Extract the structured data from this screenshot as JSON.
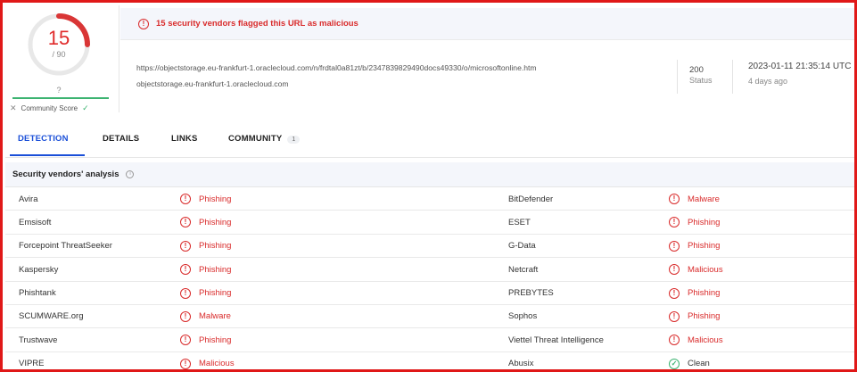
{
  "score": {
    "detections": "15",
    "total": "/ 90",
    "community_question": "?",
    "community_label": "Community Score"
  },
  "alert": {
    "icon": "alert-circle-icon",
    "text": "15 security vendors flagged this URL as malicious",
    "color": "#d92b2b"
  },
  "url": {
    "full": "https://objectstorage.eu-frankfurt-1.oraclecloud.com/n/frdtal0a81zt/b/2347839829490docs49330/o/microsoftonline.htm",
    "host": "objectstorage.eu-frankfurt-1.oraclecloud.com"
  },
  "status": {
    "code": "200",
    "label": "Status"
  },
  "date": {
    "timestamp": "2023-01-11 21:35:14 UTC",
    "relative": "4 days ago"
  },
  "tabs": [
    {
      "label": "DETECTION",
      "active": true
    },
    {
      "label": "DETAILS",
      "active": false
    },
    {
      "label": "LINKS",
      "active": false
    },
    {
      "label": "COMMUNITY",
      "badge": "1",
      "active": false
    }
  ],
  "section": {
    "title": "Security vendors' analysis"
  },
  "colors": {
    "accent": "#1a4fd8",
    "malicious": "#d92b2b",
    "clean": "#3cb371"
  },
  "vendors": [
    {
      "left": {
        "name": "Avira",
        "result": "Phishing",
        "status": "malicious"
      },
      "right": {
        "name": "BitDefender",
        "result": "Malware",
        "status": "malicious"
      }
    },
    {
      "left": {
        "name": "Emsisoft",
        "result": "Phishing",
        "status": "malicious"
      },
      "right": {
        "name": "ESET",
        "result": "Phishing",
        "status": "malicious"
      }
    },
    {
      "left": {
        "name": "Forcepoint ThreatSeeker",
        "result": "Phishing",
        "status": "malicious"
      },
      "right": {
        "name": "G-Data",
        "result": "Phishing",
        "status": "malicious"
      }
    },
    {
      "left": {
        "name": "Kaspersky",
        "result": "Phishing",
        "status": "malicious"
      },
      "right": {
        "name": "Netcraft",
        "result": "Malicious",
        "status": "malicious"
      }
    },
    {
      "left": {
        "name": "Phishtank",
        "result": "Phishing",
        "status": "malicious"
      },
      "right": {
        "name": "PREBYTES",
        "result": "Phishing",
        "status": "malicious"
      }
    },
    {
      "left": {
        "name": "SCUMWARE.org",
        "result": "Malware",
        "status": "malicious"
      },
      "right": {
        "name": "Sophos",
        "result": "Phishing",
        "status": "malicious"
      }
    },
    {
      "left": {
        "name": "Trustwave",
        "result": "Phishing",
        "status": "malicious"
      },
      "right": {
        "name": "Viettel Threat Intelligence",
        "result": "Malicious",
        "status": "malicious"
      }
    },
    {
      "left": {
        "name": "VIPRE",
        "result": "Malicious",
        "status": "malicious"
      },
      "right": {
        "name": "Abusix",
        "result": "Clean",
        "status": "clean"
      }
    }
  ]
}
